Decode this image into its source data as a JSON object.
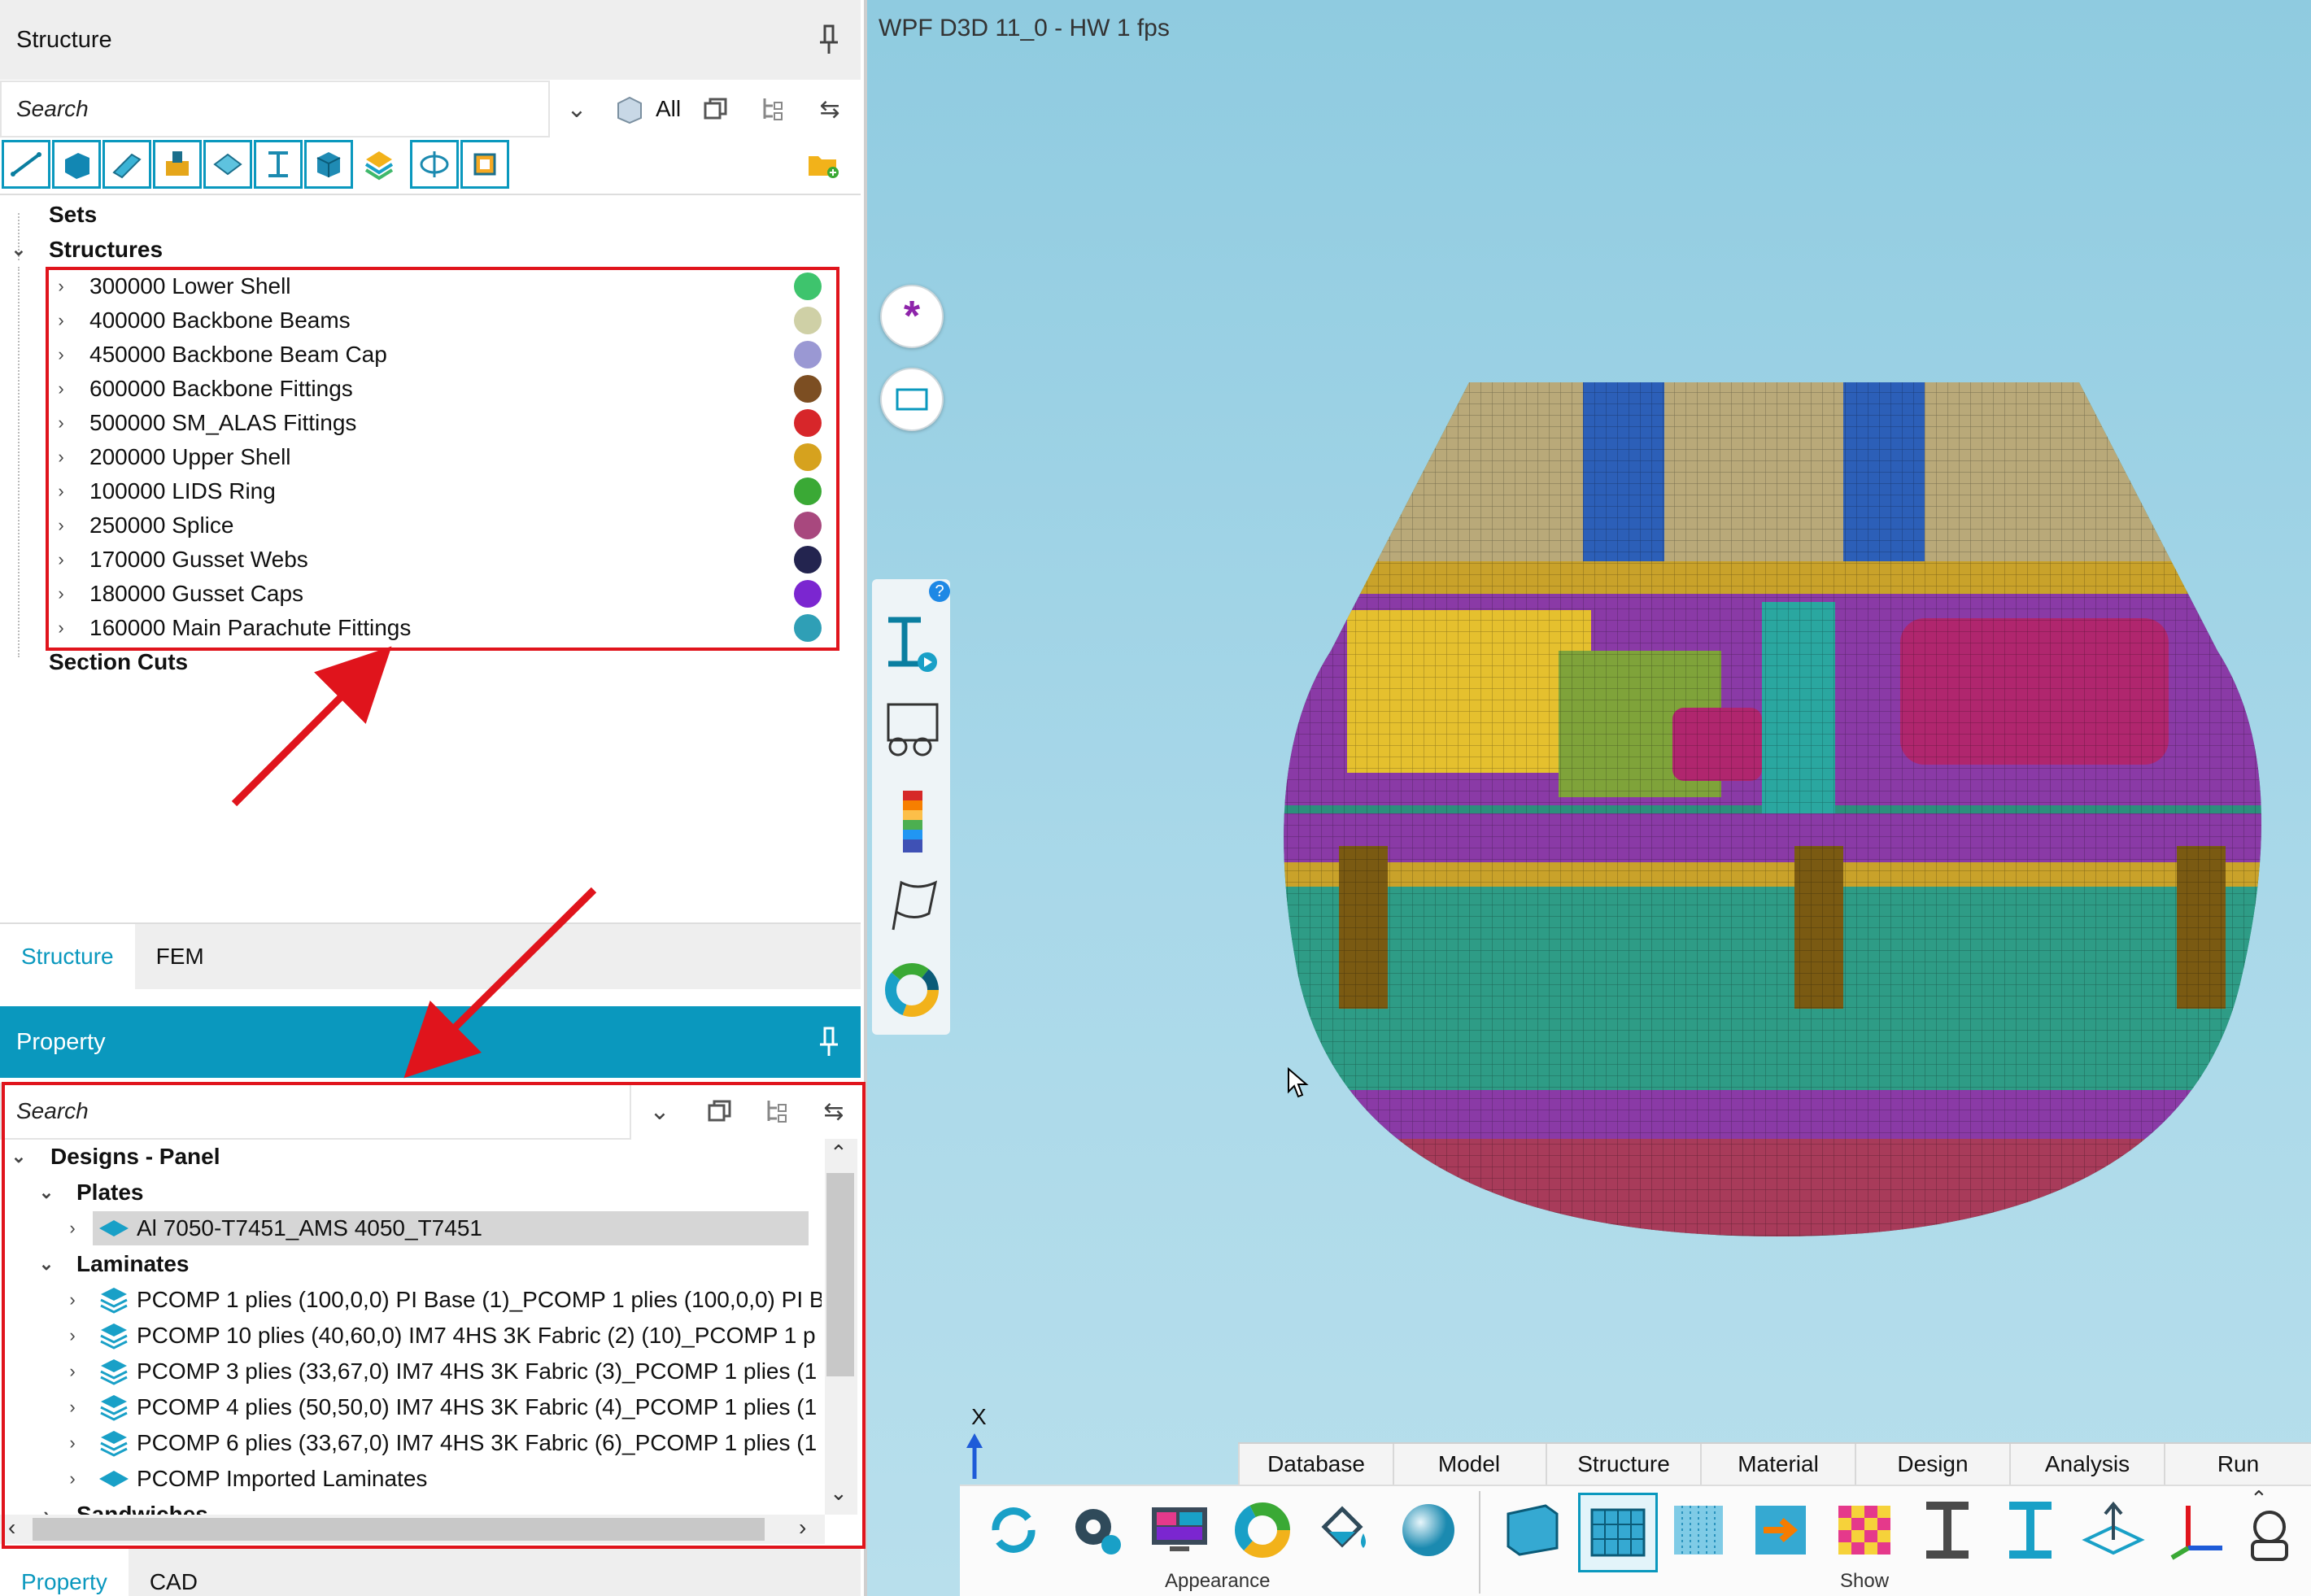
{
  "structure_panel": {
    "title": "Structure",
    "search_placeholder": "Search",
    "filter_label": "All",
    "tree": {
      "sets": "Sets",
      "structures": "Structures",
      "section_cuts": "Section Cuts",
      "items": [
        {
          "label": "300000 Lower Shell",
          "color": "#3ec46d"
        },
        {
          "label": "400000 Backbone Beams",
          "color": "#cfd0a6"
        },
        {
          "label": "450000 Backbone Beam Cap",
          "color": "#9a98d3"
        },
        {
          "label": "600000 Backbone Fittings",
          "color": "#7c4e22"
        },
        {
          "label": "500000 SM_ALAS Fittings",
          "color": "#d7262a"
        },
        {
          "label": "200000 Upper Shell",
          "color": "#d6a21e"
        },
        {
          "label": "100000 LIDS Ring",
          "color": "#3aa935"
        },
        {
          "label": "250000 Splice",
          "color": "#a8487e"
        },
        {
          "label": "170000 Gusset Webs",
          "color": "#23244f"
        },
        {
          "label": "180000 Gusset Caps",
          "color": "#7b26d0"
        },
        {
          "label": "160000 Main Parachute Fittings",
          "color": "#2f9fb6"
        }
      ]
    },
    "tabs": [
      "Structure",
      "FEM"
    ]
  },
  "property_panel": {
    "title": "Property",
    "search_placeholder": "Search",
    "tree": {
      "designs": "Designs - Panel",
      "plates": "Plates",
      "plate_items": [
        "Al 7050-T7451_AMS 4050_T7451"
      ],
      "laminates": "Laminates",
      "laminate_items": [
        "PCOMP 1 plies (100,0,0) PI Base (1)_PCOMP 1 plies (100,0,0) PI B",
        "PCOMP 10 plies (40,60,0) IM7 4HS 3K Fabric (2) (10)_PCOMP 1 p",
        "PCOMP 3 plies (33,67,0) IM7 4HS 3K Fabric (3)_PCOMP 1 plies (1",
        "PCOMP 4 plies (50,50,0) IM7 4HS 3K Fabric (4)_PCOMP 1 plies (1",
        "PCOMP 6 plies (33,67,0) IM7 4HS 3K Fabric (6)_PCOMP 1 plies (1",
        "PCOMP Imported Laminates"
      ],
      "sandwiches": "Sandwiches"
    },
    "tabs": [
      "Property",
      "CAD"
    ]
  },
  "viewport": {
    "title": "WPF D3D 11_0 - HW  1 fps",
    "axis_label": "X"
  },
  "ribbon": {
    "tabs": [
      "Database",
      "Model",
      "Structure",
      "Material",
      "Design",
      "Analysis",
      "Run"
    ],
    "groups": [
      "Appearance",
      "Show"
    ]
  },
  "colors": {
    "accent": "#0a98be",
    "annotation_red": "#e0141c"
  }
}
